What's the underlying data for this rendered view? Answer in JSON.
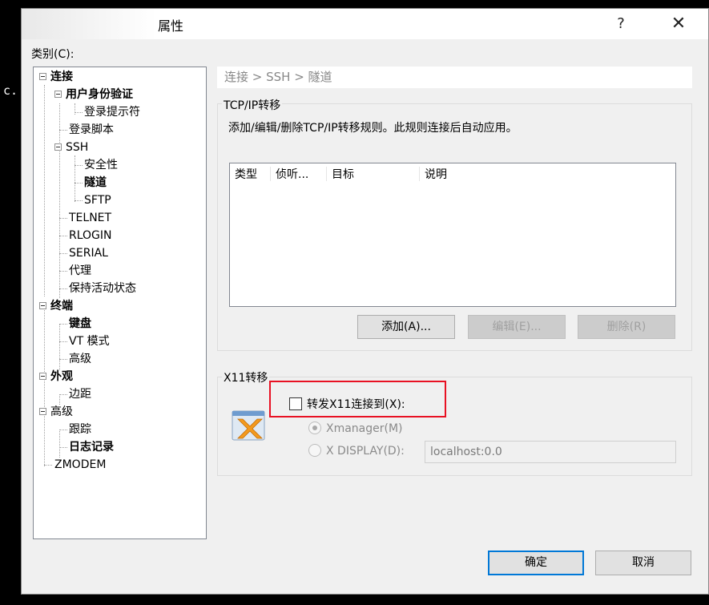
{
  "background": {
    "terminal_text": "c."
  },
  "window": {
    "title": "属性",
    "help": "?",
    "close": "✕"
  },
  "category_label": "类别(C):",
  "tree": {
    "connection": "连接",
    "user_auth": "用户身份验证",
    "login_prompts": "登录提示符",
    "login_script": "登录脚本",
    "ssh": "SSH",
    "security": "安全性",
    "tunnel": "隧道",
    "sftp": "SFTP",
    "telnet": "TELNET",
    "rlogin": "RLOGIN",
    "serial": "SERIAL",
    "proxy": "代理",
    "keepalive": "保持活动状态",
    "terminal": "终端",
    "keyboard": "键盘",
    "vt_mode": "VT 模式",
    "advanced_term": "高级",
    "appearance": "外观",
    "margins": "边距",
    "advanced": "高级",
    "trace": "跟踪",
    "logging": "日志记录",
    "zmodem": "ZMODEM"
  },
  "breadcrumb": "连接 > SSH > 隧道",
  "tcpip": {
    "title": "TCP/IP转移",
    "description": "添加/编辑/删除TCP/IP转移规则。此规则连接后自动应用。",
    "columns": {
      "type": "类型",
      "listen": "侦听...",
      "target": "目标",
      "note": "说明"
    },
    "add": "添加(A)...",
    "edit": "编辑(E)...",
    "delete": "删除(R)"
  },
  "x11": {
    "title": "X11转移",
    "forward_label": "转发X11连接到(X):",
    "xmanager": "Xmanager(M)",
    "xdisplay": "X DISPLAY(D):",
    "display_value": "localhost:0.0"
  },
  "footer": {
    "ok": "确定",
    "cancel": "取消"
  },
  "colors": {
    "highlight": "#e81123",
    "primary_border": "#0078d7"
  }
}
